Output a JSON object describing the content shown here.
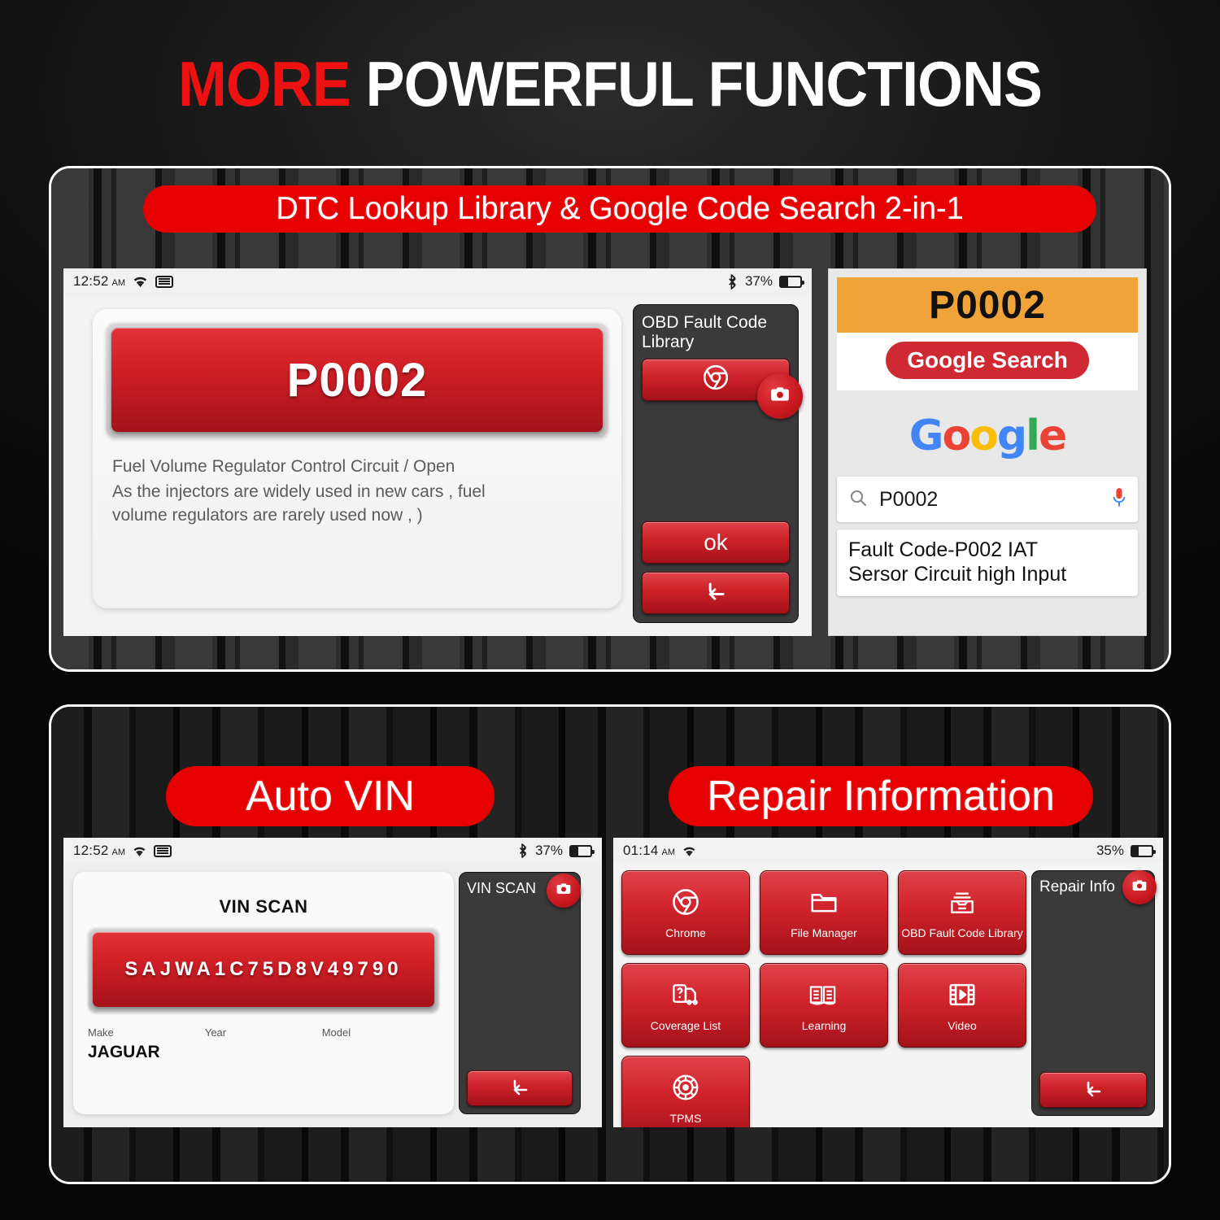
{
  "headline": {
    "red": "MORE",
    "white": "POWERFUL FUNCTIONS"
  },
  "banners": {
    "dtc": "DTC Lookup Library & Google Code Search 2-in-1",
    "auto_vin": "Auto VIN",
    "repair_information": "Repair Information"
  },
  "colors": {
    "accent_red": "#e60000",
    "button_red": "#d0232b",
    "amber": "#efa339",
    "panel_border": "#ffffff",
    "google_blue": "#4285F4",
    "google_red": "#EA4335",
    "google_yellow": "#FBBC05",
    "google_green": "#34A853"
  },
  "dtc_screen": {
    "status": {
      "time": "12:52",
      "ampm": "AM",
      "wifi_icon": "wifi-icon",
      "keyboard_icon": "keyboard-icon",
      "bluetooth_icon": "bluetooth-icon",
      "battery_percent": "37%",
      "battery_icon": "battery-icon"
    },
    "code": "P0002",
    "description_line1": "Fuel Volume Regulator Control Circuit / Open",
    "description_line2": "As the injectors are widely used in new cars , fuel",
    "description_line3": "volume regulators are rarely used now , )",
    "sidebar": {
      "title": "OBD Fault Code Library",
      "chrome_icon": "chrome-icon",
      "camera_icon": "camera-icon",
      "ok_label": "ok",
      "back_icon": "back-arrow-icon"
    }
  },
  "google_card": {
    "code": "P0002",
    "search_button": "Google Search",
    "logo": "Google",
    "logo_letters": [
      "G",
      "o",
      "o",
      "g",
      "l",
      "e"
    ],
    "search_icon": "search-icon",
    "query": "P0002",
    "mic_icon": "microphone-icon",
    "result_line1": "Fault Code-P002 IAT",
    "result_line2": "Sersor Circuit high Input"
  },
  "vin_screen": {
    "status": {
      "time": "12:52",
      "ampm": "AM",
      "wifi_icon": "wifi-icon",
      "keyboard_icon": "keyboard-icon",
      "bluetooth_icon": "bluetooth-icon",
      "battery_percent": "37%",
      "battery_icon": "battery-icon"
    },
    "title": "VIN SCAN",
    "vin": "SAJWA1C75D8V49790",
    "fields": [
      {
        "label": "Make",
        "value": "JAGUAR"
      },
      {
        "label": "Year",
        "value": ""
      },
      {
        "label": "Model",
        "value": ""
      }
    ],
    "sidebar": {
      "title": "VIN SCAN",
      "camera_icon": "camera-icon",
      "back_icon": "back-arrow-icon"
    }
  },
  "repair_screen": {
    "status": {
      "time": "01:14",
      "ampm": "AM",
      "wifi_icon": "wifi-icon",
      "battery_percent": "35%",
      "battery_icon": "battery-icon"
    },
    "tiles": [
      {
        "label": "Chrome",
        "icon": "chrome-icon"
      },
      {
        "label": "File Manager",
        "icon": "folder-icon"
      },
      {
        "label": "OBD Fault Code Library",
        "icon": "file-tray-icon"
      },
      {
        "label": "Coverage List",
        "icon": "vehicle-question-icon"
      },
      {
        "label": "Learning",
        "icon": "open-book-icon"
      },
      {
        "label": "Video",
        "icon": "film-play-icon"
      },
      {
        "label": "TPMS",
        "icon": "tire-icon"
      }
    ],
    "sidebar": {
      "title": "Repair Info",
      "camera_icon": "camera-icon",
      "back_icon": "back-arrow-icon"
    }
  }
}
